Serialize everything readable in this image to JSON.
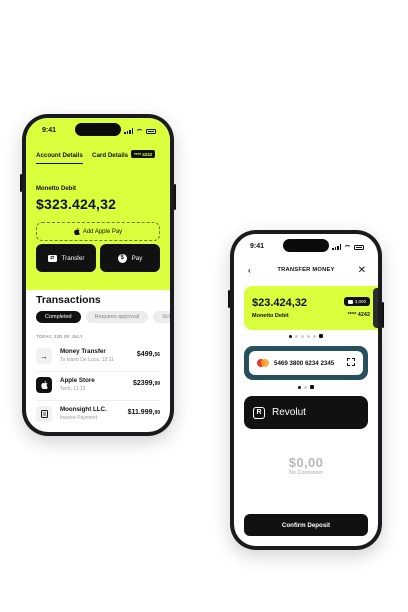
{
  "phone1": {
    "status": {
      "time": "9:41"
    },
    "tabs": [
      {
        "label": "Account Details"
      },
      {
        "label": "Card Details"
      }
    ],
    "card_badge": "**** 4242",
    "account": {
      "label": "Monetto Debit",
      "balance": "$323.424,32"
    },
    "apple_pay_label": "Add Apple Pay",
    "actions": {
      "transfer": "Transfer",
      "pay": "Pay",
      "pay_icon": "$"
    },
    "transactions": {
      "title": "Transactions",
      "filters": [
        {
          "label": "Completed"
        },
        {
          "label": "Requires approval"
        },
        {
          "label": "Sch"
        }
      ],
      "date_label": "TODAY, 23D OF JULY",
      "items": [
        {
          "name": "Money Transfer",
          "sub": "To Ivano De Luca, 12:11",
          "amount": "$499,",
          "decimals": "56",
          "icon": "arrow-right-icon"
        },
        {
          "name": "Apple Store",
          "sub": "Tech, 11:12",
          "amount": "$2399,",
          "decimals": "99",
          "icon": "apple-icon"
        },
        {
          "name": "Moonsight LLC.",
          "sub": "Invoice Payment",
          "amount": "$11.999,",
          "decimals": "99",
          "icon": "document-icon"
        }
      ]
    }
  },
  "phone2": {
    "status": {
      "time": "9:41"
    },
    "header": {
      "title": "TRANSFER MONEY"
    },
    "source_card": {
      "amount": "$23.424,32",
      "name": "Monetto Debit",
      "pill": "3,000",
      "number": "**** 4242"
    },
    "dest_card": {
      "number": "5469 3800 6234 2345"
    },
    "provider": {
      "logo": "R",
      "name": "Revolut"
    },
    "deposit": {
      "amount": "$0,00",
      "sub": "No Comission"
    },
    "confirm_label": "Confirm Deposit"
  },
  "colors": {
    "accent": "#d9ff3d",
    "dark": "#111111",
    "teal": "#274f5c"
  }
}
